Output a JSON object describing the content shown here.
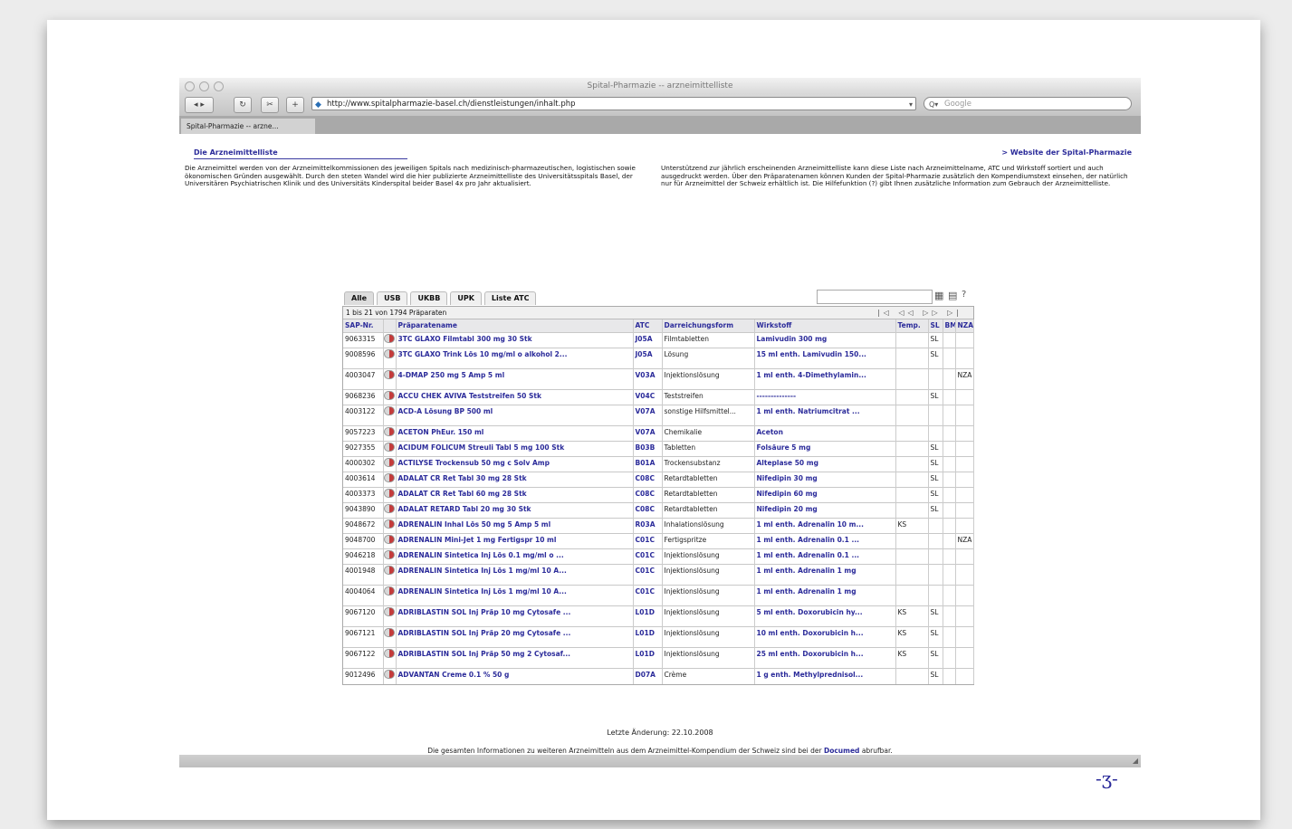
{
  "window": {
    "title": "Spital-Pharmazie -- arzneimittelliste",
    "url": "http://www.spitalpharmazie-basel.ch/dienstleistungen/inhalt.php",
    "search_placeholder": "Google",
    "tab_label": "Spital-Pharmazie -- arzne..."
  },
  "page": {
    "heading": "Die Arzneimittelliste",
    "site_link": "> Website der Spital-Pharmazie",
    "left_paragraph": "Die Arzneimittel werden von der Arzneimittelkommissionen des jeweiligen Spitals nach medizinisch-pharmazeutischen, logistischen sowie ökonomischen Gründen ausgewählt. Durch den steten Wandel wird die hier publizierte Arzneimittelliste des Universitätsspitals Basel, der Universitären Psychiatrischen Klinik und des Universitäts Kinderspital beider Basel 4x pro Jahr aktualisiert.",
    "right_paragraph": "Unterstützend zur jährlich erscheinenden Arzneimittelliste kann diese Liste nach Arzneimittelname, ATC und Wirkstoff sortiert und auch ausgedruckt werden. Über den Präparatenamen können Kunden der Spital-Pharmazie zusätzlich den Kompendiumstext einsehen, der natürlich nur für Arzneimittel der Schweiz erhältlich ist. Die Hilfefunktion (?) gibt Ihnen zusätzliche Information zum Gebrauch der Arzneimittelliste."
  },
  "filter_tabs": [
    "Alle",
    "USB",
    "UKBB",
    "UPK",
    "Liste ATC"
  ],
  "table": {
    "info": "1 bis 21 von 1794 Präparaten",
    "pager": "|◁ ◁◁ ▷▷ ▷|",
    "headers": [
      "SAP-Nr.",
      "",
      "Präparatename",
      "ATC",
      "Darreichungsform",
      "Wirkstoff",
      "Temp.",
      "SL",
      "BM",
      "NZA"
    ],
    "rows": [
      [
        "9063315",
        "3TC GLAXO Filmtabl 300 mg 30 Stk",
        "J05A",
        "Filmtabletten",
        "Lamivudin 300 mg",
        "",
        "SL",
        "",
        ""
      ],
      [
        "9008596",
        "3TC GLAXO Trink Lös 10 mg/ml o alkohol 2...",
        "J05A",
        "Lösung",
        "15 ml enth. Lamivudin 150...",
        "",
        "SL",
        "",
        ""
      ],
      [
        "4003047",
        "4-DMAP 250 mg 5 Amp 5 ml",
        "V03A",
        "Injektionslösung",
        "1 ml enth. 4-Dimethylamin...",
        "",
        "",
        "",
        "NZA"
      ],
      [
        "9068236",
        "ACCU CHEK AVIVA Teststreifen 50 Stk",
        "V04C",
        "Teststreifen",
        "--------------",
        "",
        "SL",
        "",
        ""
      ],
      [
        "4003122",
        "ACD-A Lösung BP 500 ml",
        "V07A",
        "sonstige Hilfsmittel...",
        "1 ml enth. Natriumcitrat ...",
        "",
        "",
        "",
        ""
      ],
      [
        "9057223",
        "ACETON PhEur. 150 ml",
        "V07A",
        "Chemikalie",
        "Aceton",
        "",
        "",
        "",
        ""
      ],
      [
        "9027355",
        "ACIDUM FOLICUM Streuli Tabl 5 mg 100 Stk",
        "B03B",
        "Tabletten",
        "Folsäure 5 mg",
        "",
        "SL",
        "",
        ""
      ],
      [
        "4000302",
        "ACTILYSE Trockensub 50 mg c Solv Amp",
        "B01A",
        "Trockensubstanz",
        "Alteplase 50 mg",
        "",
        "SL",
        "",
        ""
      ],
      [
        "4003614",
        "ADALAT CR Ret Tabl 30 mg 28 Stk",
        "C08C",
        "Retardtabletten",
        "Nifedipin 30 mg",
        "",
        "SL",
        "",
        ""
      ],
      [
        "4003373",
        "ADALAT CR Ret Tabl 60 mg 28 Stk",
        "C08C",
        "Retardtabletten",
        "Nifedipin 60 mg",
        "",
        "SL",
        "",
        ""
      ],
      [
        "9043890",
        "ADALAT RETARD Tabl 20 mg 30 Stk",
        "C08C",
        "Retardtabletten",
        "Nifedipin 20 mg",
        "",
        "SL",
        "",
        ""
      ],
      [
        "9048672",
        "ADRENALIN Inhal Lös 50 mg 5 Amp 5 ml",
        "R03A",
        "Inhalationslösung",
        "1 ml enth. Adrenalin 10 m...",
        "KS",
        "",
        "",
        ""
      ],
      [
        "9048700",
        "ADRENALIN Mini-Jet 1 mg Fertigspr 10 ml",
        "C01C",
        "Fertigspritze",
        "1 ml enth. Adrenalin 0.1 ...",
        "",
        "",
        "",
        "NZA"
      ],
      [
        "9046218",
        "ADRENALIN Sintetica Inj Lös 0.1 mg/ml o ...",
        "C01C",
        "Injektionslösung",
        "1 ml enth. Adrenalin 0.1 ...",
        "",
        "",
        "",
        ""
      ],
      [
        "4001948",
        "ADRENALIN Sintetica Inj Lös 1 mg/ml 10 A...",
        "C01C",
        "Injektionslösung",
        "1 ml enth. Adrenalin 1 mg",
        "",
        "",
        "",
        ""
      ],
      [
        "4004064",
        "ADRENALIN Sintetica Inj Lös 1 mg/ml 10 A...",
        "C01C",
        "Injektionslösung",
        "1 ml enth. Adrenalin 1 mg",
        "",
        "",
        "",
        ""
      ],
      [
        "9067120",
        "ADRIBLASTIN SOL Inj Präp 10 mg Cytosafe ...",
        "L01D",
        "Injektionslösung",
        "5 ml enth. Doxorubicin hy...",
        "KS",
        "SL",
        "",
        ""
      ],
      [
        "9067121",
        "ADRIBLASTIN SOL Inj Präp 20 mg Cytosafe ...",
        "L01D",
        "Injektionslösung",
        "10 ml enth. Doxorubicin h...",
        "KS",
        "SL",
        "",
        ""
      ],
      [
        "9067122",
        "ADRIBLASTIN SOL Inj Präp 50 mg 2 Cytosaf...",
        "L01D",
        "Injektionslösung",
        "25 ml enth. Doxorubicin h...",
        "KS",
        "SL",
        "",
        ""
      ],
      [
        "9012496",
        "ADVANTAN Creme 0.1 % 50 g",
        "D07A",
        "Crème",
        "1 g enth. Methylprednisol...",
        "",
        "SL",
        "",
        ""
      ]
    ]
  },
  "footer": {
    "last_change": "Letzte Änderung: 22.10.2008",
    "note_before": "Die gesamten Informationen zu weiteren Arzneimitteln aus dem Arzneimittel-Kompendium der Schweiz sind bei der",
    "note_link": "Documed",
    "note_after": "abrufbar."
  },
  "colors": {
    "link": "#2b2b9a",
    "pill_red": "#c43b3b"
  }
}
